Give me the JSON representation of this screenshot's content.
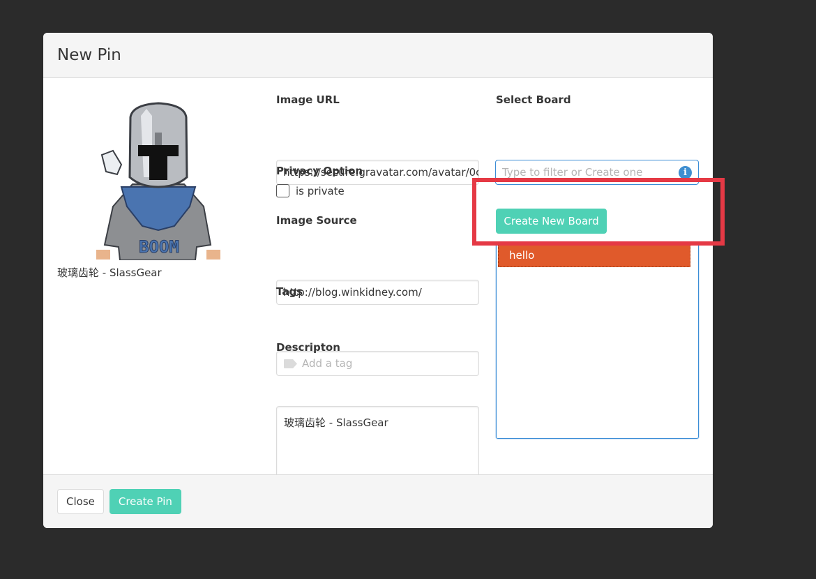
{
  "modal": {
    "title": "New Pin"
  },
  "preview": {
    "caption": "玻璃齿轮 - SlassGear"
  },
  "form": {
    "image_url_label": "Image URL",
    "image_url_value": "https://secure.gravatar.com/avatar/0c",
    "privacy_label": "Privacy Option",
    "private_checkbox_label": "is private",
    "image_source_label": "Image Source",
    "image_source_value": "http://blog.winkidney.com/",
    "tags_label": "Tags",
    "tags_placeholder": "Add a tag",
    "description_label": "Descripton",
    "description_value": "玻璃齿轮 - SlassGear"
  },
  "board": {
    "label": "Select Board",
    "filter_placeholder": "Type to filter or Create one",
    "create_button": "Create New Board",
    "items": [
      {
        "label": "hello",
        "selected": true
      }
    ]
  },
  "footer": {
    "close_button": "Close",
    "create_button": "Create Pin"
  },
  "colors": {
    "accent": "#4fd1b5",
    "selected_board": "#e05a2b",
    "highlight_box": "#e53945",
    "focus_border": "#3b8dd6"
  }
}
